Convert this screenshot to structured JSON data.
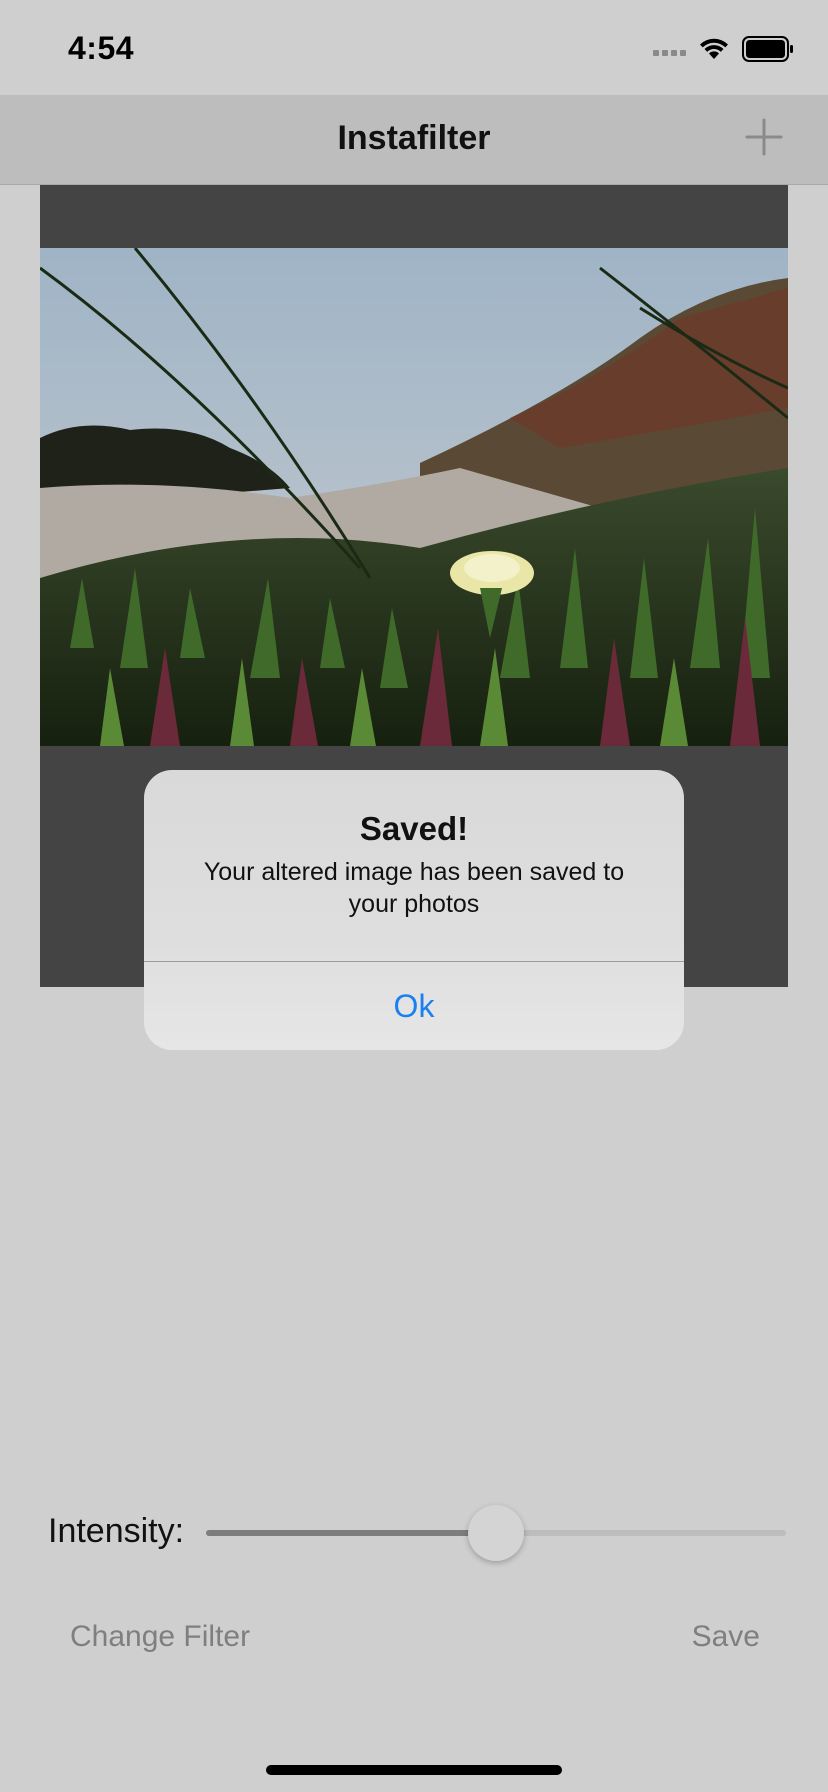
{
  "status_bar": {
    "time": "4:54",
    "signal_icon": "cellular-signal-icon",
    "wifi_icon": "wifi-icon",
    "battery_icon": "battery-icon"
  },
  "nav": {
    "title": "Instafilter",
    "add_icon": "plus-icon"
  },
  "alert": {
    "title": "Saved!",
    "message": "Your altered image has been saved to your photos",
    "button_label": "Ok",
    "button_color": "#1a7ff0"
  },
  "controls": {
    "intensity_label": "Intensity:",
    "intensity_value": 0.5,
    "change_filter_label": "Change Filter",
    "save_label": "Save"
  }
}
